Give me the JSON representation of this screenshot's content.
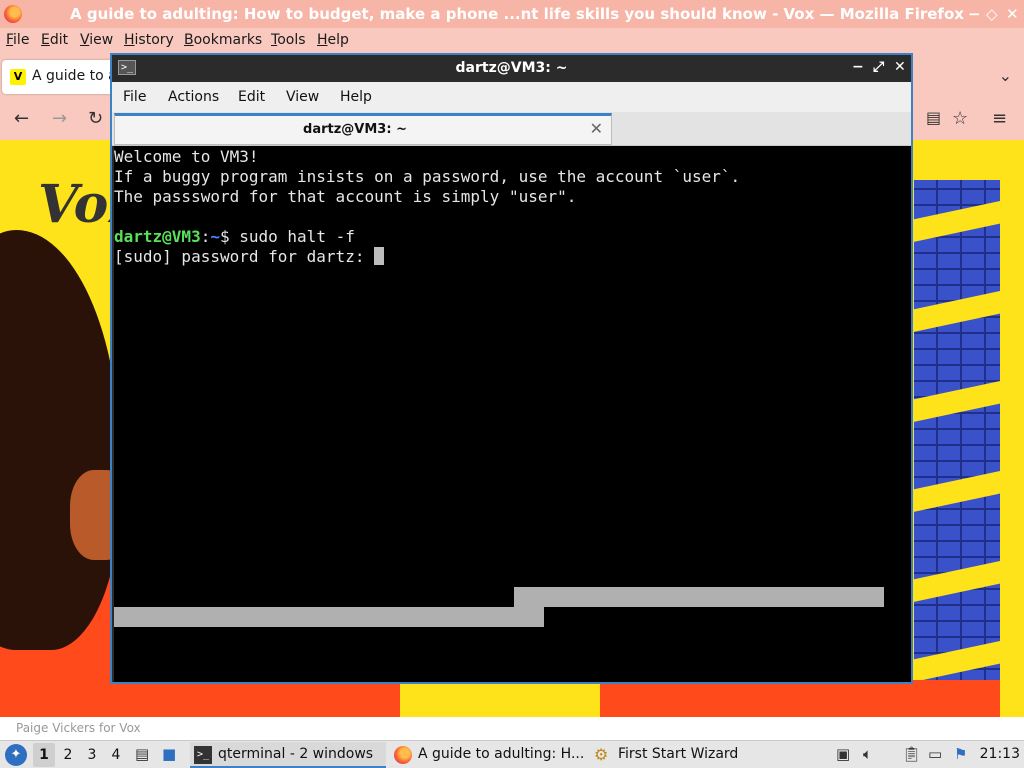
{
  "firefox": {
    "window_title": "A guide to adulting: How to budget, make a phone ...nt life skills you should know - Vox — Mozilla Firefox",
    "menu": [
      "File",
      "Edit",
      "View",
      "History",
      "Bookmarks",
      "Tools",
      "Help"
    ],
    "tab_label": "A guide to a",
    "tab_favicon": "V",
    "page_logo": "Vox",
    "photo_credit": "Paige Vickers for Vox",
    "window_controls": {
      "minimize": "−",
      "restore": "◇",
      "close": "✕"
    }
  },
  "terminal": {
    "title": "dartz@VM3: ~",
    "menu": [
      "File",
      "Actions",
      "Edit",
      "View",
      "Help"
    ],
    "tab_label": "dartz@VM3: ~",
    "lines": [
      "Welcome to VM3!",
      "If a buggy program insists on a password, use the account `user`.",
      "The passsword for that account is simply \"user\".",
      ""
    ],
    "prompt": {
      "user_host": "dartz@VM3",
      "colon": ":",
      "path": "~",
      "symbol": "$ ",
      "command": "sudo halt -f"
    },
    "sudo_prompt": "[sudo] password for dartz: "
  },
  "taskbar": {
    "desktops": [
      "1",
      "2",
      "3",
      "4"
    ],
    "active_desktop": "1",
    "tasks": [
      {
        "label": "qterminal - 2 windows",
        "active": true
      },
      {
        "label": "A guide to adulting: H...",
        "active": false
      },
      {
        "label": "First Start Wizard",
        "active": false
      }
    ],
    "clock": "21:13"
  },
  "colors": {
    "accent": "#3c82c7",
    "prompt_user": "#5ae05a",
    "prompt_path": "#4a86ff",
    "firefox_chrome": "#f9c9c0",
    "vox_yellow": "#ffe31a"
  }
}
